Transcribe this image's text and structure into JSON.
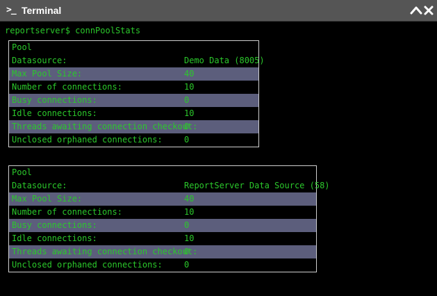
{
  "window": {
    "icon_glyph": ">_",
    "title": "Terminal"
  },
  "terminal": {
    "prompt": "reportserver$ connPoolStats",
    "colors": {
      "background": "#000000",
      "text": "#2bc82b",
      "shaded_row": "#5c5e7c",
      "border": "#d0d0d0",
      "titlebar": "#555555"
    },
    "pools": [
      {
        "header": "Pool",
        "rows": [
          {
            "key": "Datasource:",
            "value": "Demo Data (8005)"
          },
          {
            "key": "Max Pool Size:",
            "value": "40"
          },
          {
            "key": "Number of connections:",
            "value": "10"
          },
          {
            "key": "Busy connections:",
            "value": "0"
          },
          {
            "key": "Idle connections:",
            "value": "10"
          },
          {
            "key": "Threads awaiting connection checkout:",
            "value": "0"
          },
          {
            "key": "Unclosed orphaned connections:",
            "value": "0"
          }
        ]
      },
      {
        "header": "Pool",
        "rows": [
          {
            "key": "Datasource:",
            "value": "ReportServer Data Source (58)"
          },
          {
            "key": "Max Pool Size:",
            "value": "40"
          },
          {
            "key": "Number of connections:",
            "value": "10"
          },
          {
            "key": "Busy connections:",
            "value": "0"
          },
          {
            "key": "Idle connections:",
            "value": "10"
          },
          {
            "key": "Threads awaiting connection checkout:",
            "value": "0"
          },
          {
            "key": "Unclosed orphaned connections:",
            "value": "0"
          }
        ]
      }
    ]
  }
}
